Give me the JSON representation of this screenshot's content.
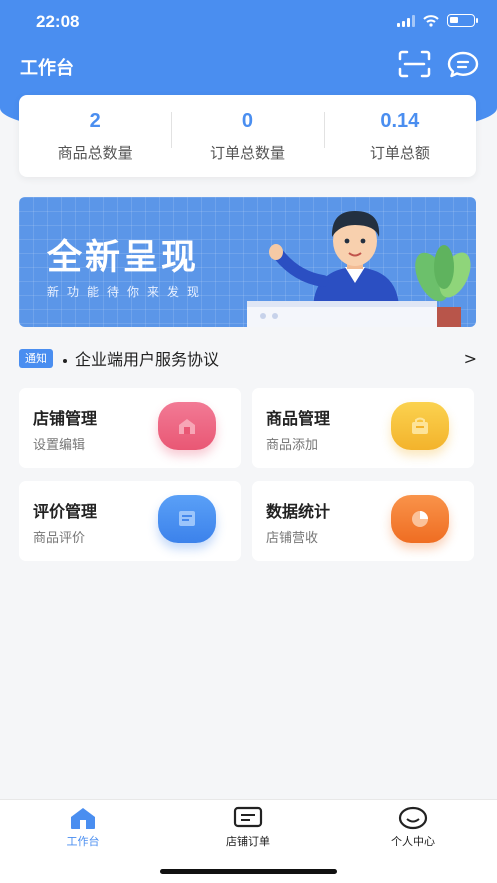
{
  "status_bar": {
    "time": "22:08"
  },
  "header": {
    "title": "工作台",
    "scan_icon": "scan-icon",
    "message_icon": "message-icon"
  },
  "stats": [
    {
      "value": "2",
      "label": "商品总数量"
    },
    {
      "value": "0",
      "label": "订单总数量"
    },
    {
      "value": "0.14",
      "label": "订单总额"
    }
  ],
  "banner": {
    "title": "全新呈现",
    "subtitle": "新功能待你来发现"
  },
  "notice": {
    "badge": "通知",
    "text": "企业端用户服务协议",
    "arrow": ">"
  },
  "tiles": [
    {
      "title": "店铺管理",
      "subtitle": "设置编辑",
      "icon": "store-icon",
      "color": "#e95774"
    },
    {
      "title": "商品管理",
      "subtitle": "商品添加",
      "icon": "bag-icon",
      "color": "#f3b32c"
    },
    {
      "title": "评价管理",
      "subtitle": "商品评价",
      "icon": "comment-icon",
      "color": "#3c82eb"
    },
    {
      "title": "数据统计",
      "subtitle": "店铺营收",
      "icon": "pie-chart-icon",
      "color": "#ef6d22"
    }
  ],
  "tabbar": {
    "items": [
      {
        "label": "工作台",
        "icon": "home-icon",
        "active": true
      },
      {
        "label": "店铺订单",
        "icon": "order-icon",
        "active": false
      },
      {
        "label": "个人中心",
        "icon": "profile-icon",
        "active": false
      }
    ]
  },
  "colors": {
    "primary": "#4a8ef0",
    "background": "#f5f6f8"
  }
}
